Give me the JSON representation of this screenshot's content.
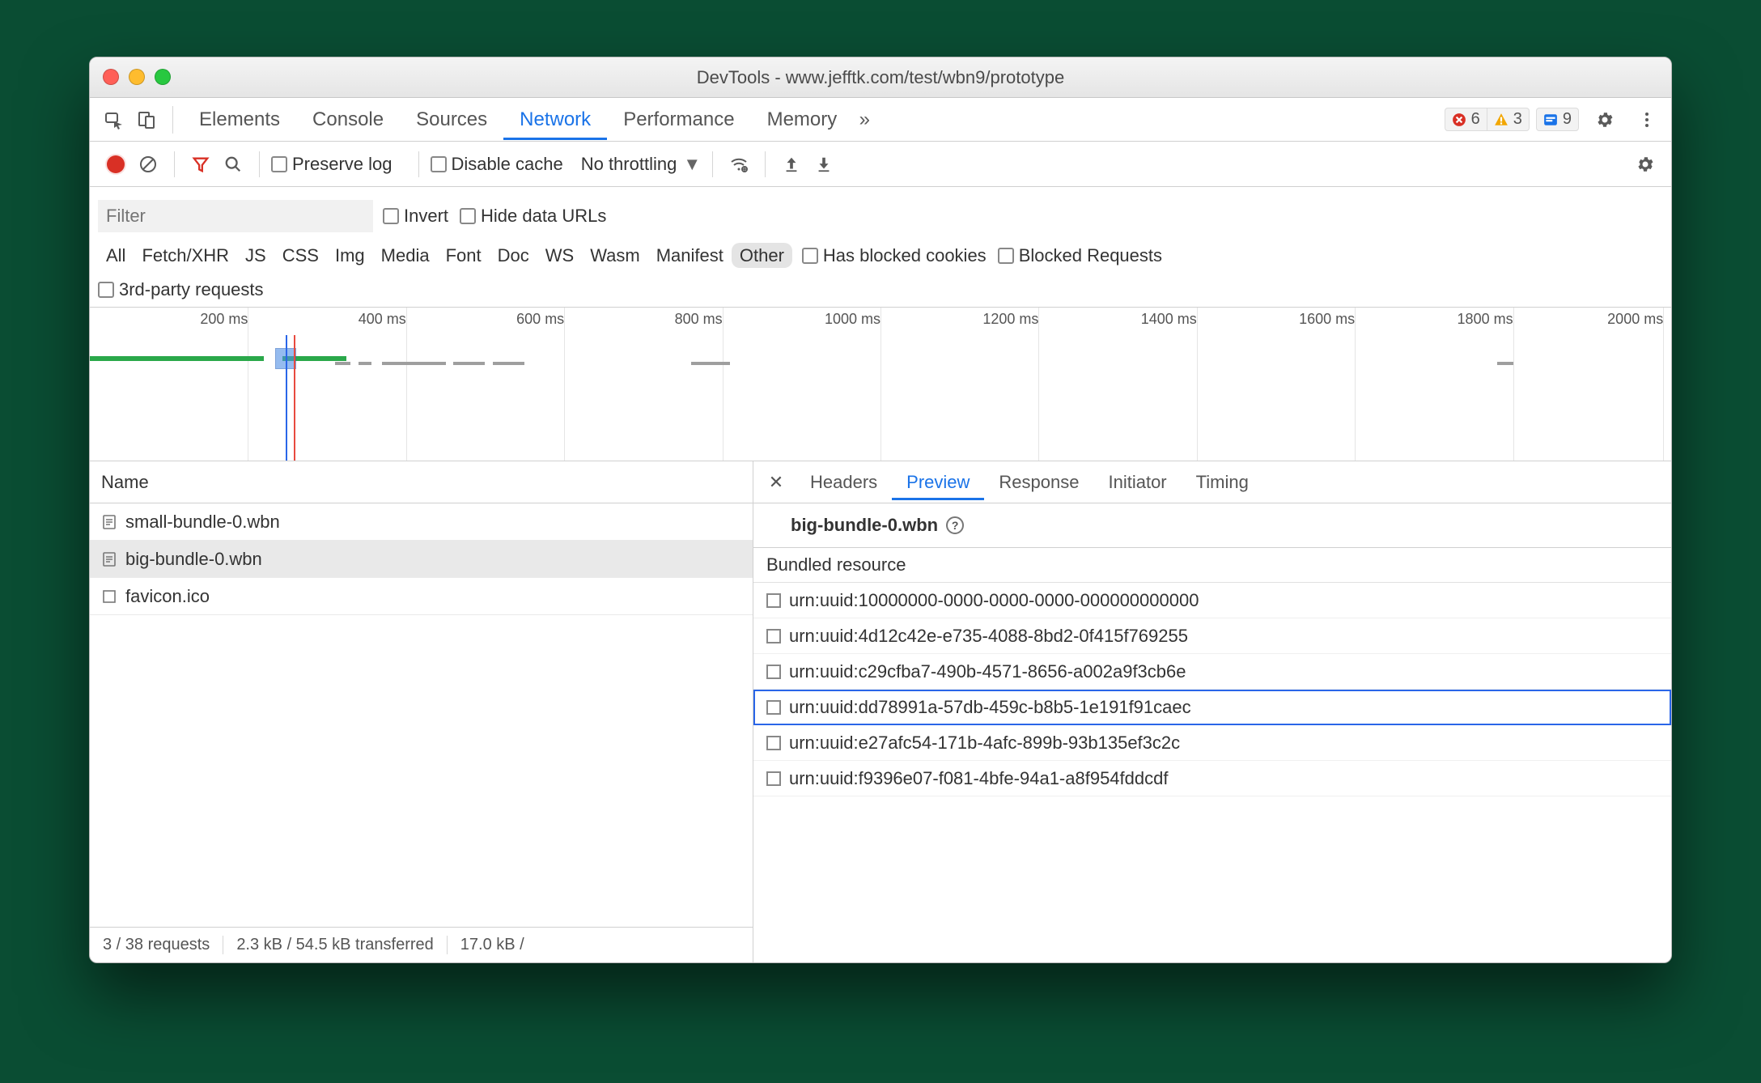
{
  "window": {
    "title": "DevTools - www.jefftk.com/test/wbn9/prototype"
  },
  "panel_tabs": {
    "items": [
      "Elements",
      "Console",
      "Sources",
      "Network",
      "Performance",
      "Memory"
    ],
    "active": "Network",
    "overflow_glyph": "»",
    "error_count": "6",
    "warning_count": "3",
    "issue_count": "9"
  },
  "toolbar": {
    "preserve_log": "Preserve log",
    "disable_cache": "Disable cache",
    "throttling": "No throttling"
  },
  "filter": {
    "placeholder": "Filter",
    "invert": "Invert",
    "hide_data_urls": "Hide data URLs",
    "type_filters": [
      "All",
      "Fetch/XHR",
      "JS",
      "CSS",
      "Img",
      "Media",
      "Font",
      "Doc",
      "WS",
      "Wasm",
      "Manifest",
      "Other"
    ],
    "active_filter": "Other",
    "has_blocked_cookies": "Has blocked cookies",
    "blocked_requests": "Blocked Requests",
    "third_party": "3rd-party requests"
  },
  "timeline": {
    "labels": [
      "200 ms",
      "400 ms",
      "600 ms",
      "800 ms",
      "1000 ms",
      "1200 ms",
      "1400 ms",
      "1600 ms",
      "1800 ms",
      "2000 ms"
    ],
    "positions_pct": [
      10,
      20,
      30,
      40,
      50,
      60,
      70,
      80,
      90,
      99.5
    ]
  },
  "request_list": {
    "header": "Name",
    "rows": [
      {
        "name": "small-bundle-0.wbn",
        "selected": false,
        "icon": "file"
      },
      {
        "name": "big-bundle-0.wbn",
        "selected": true,
        "icon": "file"
      },
      {
        "name": "favicon.ico",
        "selected": false,
        "icon": "square"
      }
    ]
  },
  "status": {
    "requests": "3 / 38 requests",
    "transferred": "2.3 kB / 54.5 kB transferred",
    "resources": "17.0 kB /"
  },
  "detail": {
    "tabs": [
      "Headers",
      "Preview",
      "Response",
      "Initiator",
      "Timing"
    ],
    "active": "Preview",
    "title": "big-bundle-0.wbn",
    "section": "Bundled resource",
    "items": [
      {
        "text": "urn:uuid:10000000-0000-0000-0000-000000000000",
        "hl": false
      },
      {
        "text": "urn:uuid:4d12c42e-e735-4088-8bd2-0f415f769255",
        "hl": false
      },
      {
        "text": "urn:uuid:c29cfba7-490b-4571-8656-a002a9f3cb6e",
        "hl": false
      },
      {
        "text": "urn:uuid:dd78991a-57db-459c-b8b5-1e191f91caec",
        "hl": true
      },
      {
        "text": "urn:uuid:e27afc54-171b-4afc-899b-93b135ef3c2c",
        "hl": false
      },
      {
        "text": "urn:uuid:f9396e07-f081-4bfe-94a1-a8f954fddcdf",
        "hl": false
      }
    ]
  }
}
